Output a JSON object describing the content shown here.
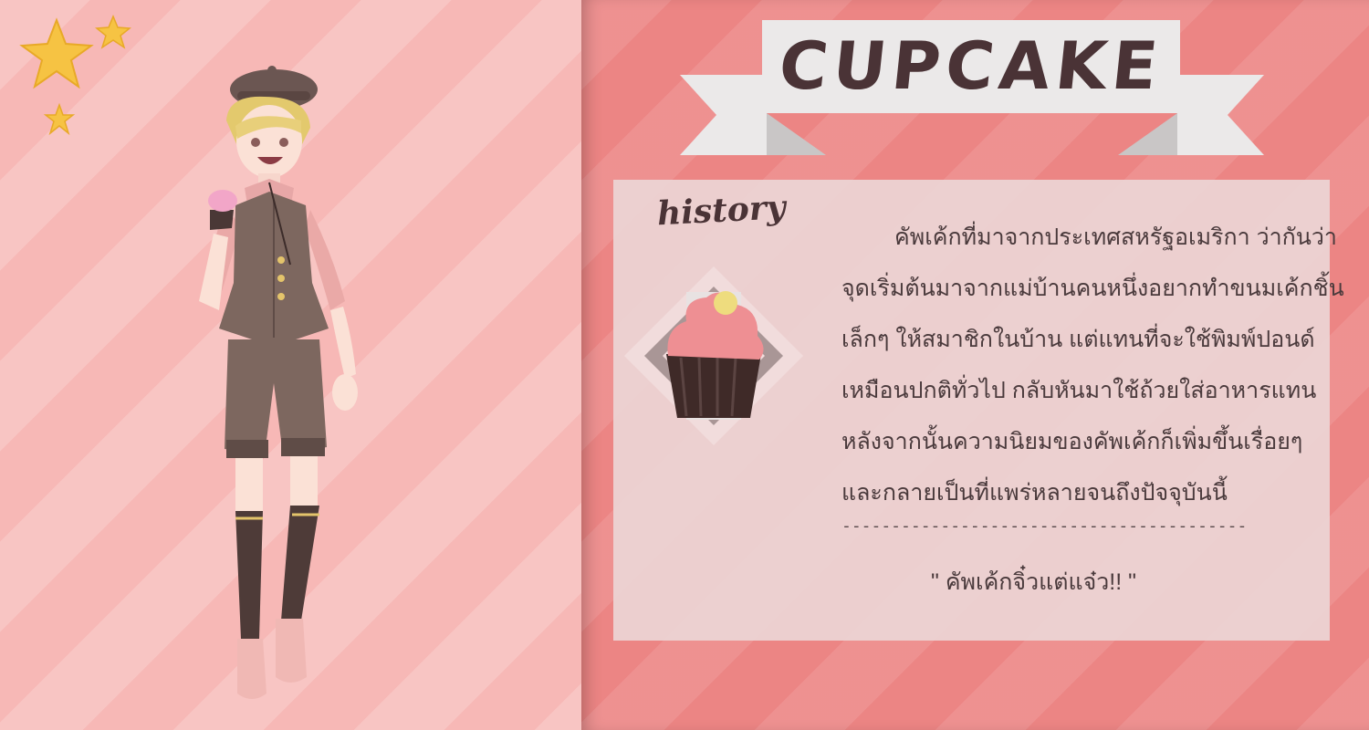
{
  "title": "CUPCAKE",
  "history_label": "history",
  "history_lines": [
    "คัพเค้กที่มาจากประเทศสหรัฐอเมริกา ว่ากันว่า",
    "จุดเริ่มต้นมาจากแม่บ้านคนหนึ่งอยากทำขนมเค้กชิ้น",
    "เล็กๆ ให้สมาชิกในบ้าน แต่แทนที่จะใช้พิมพ์ปอนด์",
    "เหมือนปกติทั่วไป กลับหันมาใช้ถ้วยใส่อาหารแทน",
    "หลังจากนั้นความนิยมของคัพเค้กก็เพิ่มขึ้นเรื่อยๆ",
    "และกลายเป็นที่แพร่หลายจนถึงปัจจุบันนี้"
  ],
  "divider": "-----------------------------------------",
  "quote": "\" คัพเค้กจิ๋วแต่แจ๋ว!! \"",
  "colors": {
    "left_bg": "#f7b8b6",
    "right_bg": "#ec8584",
    "banner": "#ebe9e9",
    "text": "#4a3336",
    "star": "#f6c343"
  },
  "icons": [
    "star-icon",
    "cupcake-icon"
  ]
}
